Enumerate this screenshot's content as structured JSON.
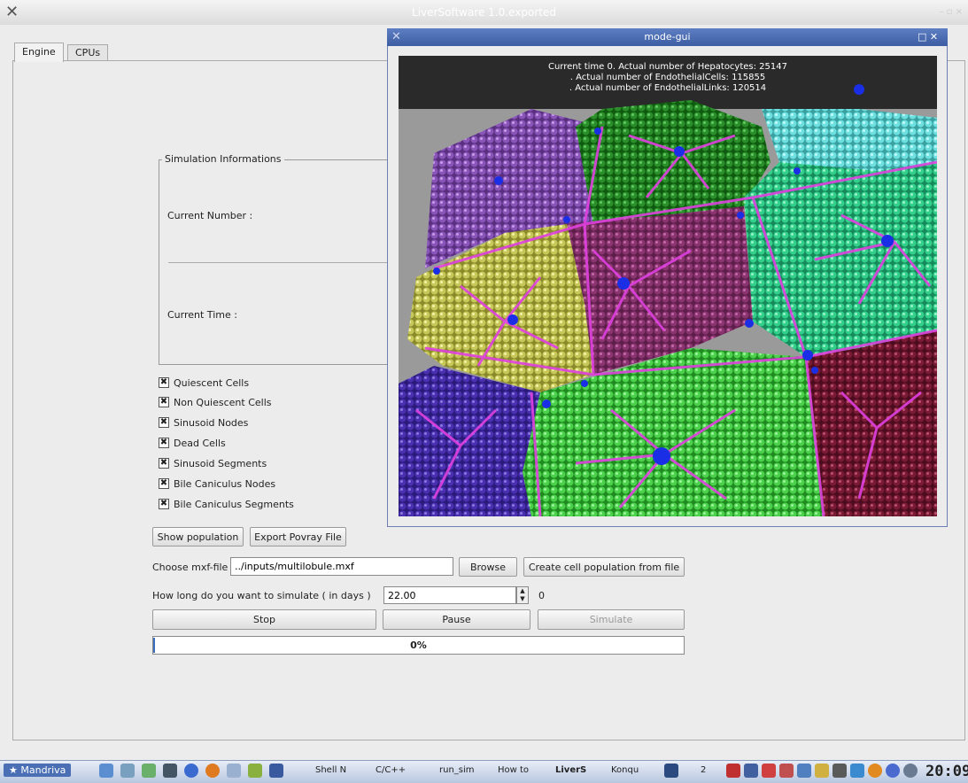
{
  "window": {
    "title": "LiverSoftware 1.0.exported",
    "controls": "– ▫ ×"
  },
  "tabs": [
    {
      "label": "Engine"
    },
    {
      "label": "CPUs"
    }
  ],
  "simulation_info": {
    "title": "Simulation Informations",
    "current_number_label": "Current Number :",
    "current_time_label": "Current Time :"
  },
  "checkboxes": [
    {
      "label": "Quiescent Cells",
      "checked": true
    },
    {
      "label": "Non Quiescent Cells",
      "checked": true
    },
    {
      "label": "Sinusoid Nodes",
      "checked": true
    },
    {
      "label": "Dead Cells",
      "checked": true
    },
    {
      "label": "Sinusoid Segments",
      "checked": true
    },
    {
      "label": "Bile Caniculus Nodes",
      "checked": true
    },
    {
      "label": "Bile Caniculus Segments",
      "checked": true
    }
  ],
  "buttons": {
    "show_population": "Show population",
    "export_povray": "Export Povray File",
    "browse": "Browse",
    "create_population": "Create cell population from file",
    "stop": "Stop",
    "pause": "Pause",
    "simulate": "Simulate"
  },
  "mxf": {
    "label": "Choose mxf-file",
    "value": "../inputs/multilobule.mxf"
  },
  "duration": {
    "label": "How long do you want to simulate ( in days )",
    "value": "22.00",
    "side_value": "0"
  },
  "progress": {
    "value": 0,
    "text": "0%"
  },
  "gui": {
    "title": "mode-gui",
    "info_lines": [
      "Current time 0. Actual number of Hepatocytes: 25147",
      ". Actual number of EndothelialCells: 115855",
      ". Actual number of EndothelialLinks: 120514"
    ]
  },
  "taskbar": {
    "start": "Mandriva",
    "tasks": [
      "Shell N",
      "C/C++",
      "run_sim",
      "How to",
      "LiverS",
      "Konqu"
    ],
    "desktop_number": "2",
    "clock": "20:09"
  }
}
